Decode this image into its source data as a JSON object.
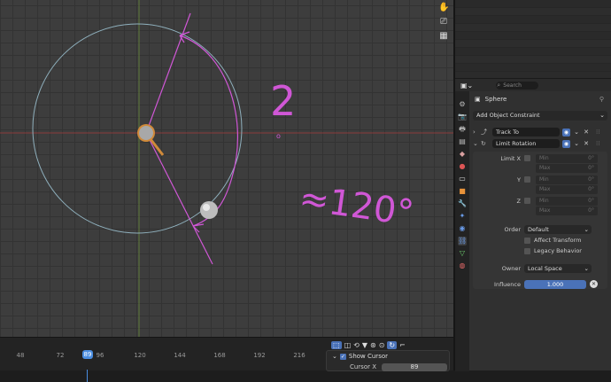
{
  "viewport": {
    "tools": [
      {
        "icon": "hand-icon",
        "glyph": "✋"
      },
      {
        "icon": "camera-icon",
        "glyph": "⎚"
      },
      {
        "icon": "grid-icon",
        "glyph": "▦"
      }
    ],
    "annotations": {
      "number_2": "2",
      "number_2_dot": "o",
      "approx": "≈120°"
    },
    "colors": {
      "annotation": "#d057d6",
      "circle": "#8fb0bd",
      "axis_red": "#8a3a3a",
      "axis_green": "#607a3a"
    }
  },
  "timeline": {
    "ticks": [
      "48",
      "72",
      "89",
      "96",
      "120",
      "144",
      "168",
      "192",
      "216"
    ],
    "current_frame": "89",
    "popup": {
      "show_cursor_label": "Show Cursor",
      "cursor_x_label": "Cursor X",
      "cursor_x_value": "89"
    }
  },
  "properties": {
    "search_placeholder": "Search",
    "object_name": "Sphere",
    "add_constraint_label": "Add Object Constraint",
    "constraints": [
      {
        "name": "Track To"
      },
      {
        "name": "Limit Rotation"
      }
    ],
    "limit": {
      "limit_x_label": "Limit X",
      "y_label": "Y",
      "z_label": "Z",
      "min_label": "Min",
      "max_label": "Max",
      "value": "0°"
    },
    "order_label": "Order",
    "order_value": "Default",
    "affect_transform": "Affect Transform",
    "legacy_behavior": "Legacy Behavior",
    "owner_label": "Owner",
    "owner_value": "Local Space",
    "influence_label": "Influence",
    "influence_value": "1.000"
  }
}
